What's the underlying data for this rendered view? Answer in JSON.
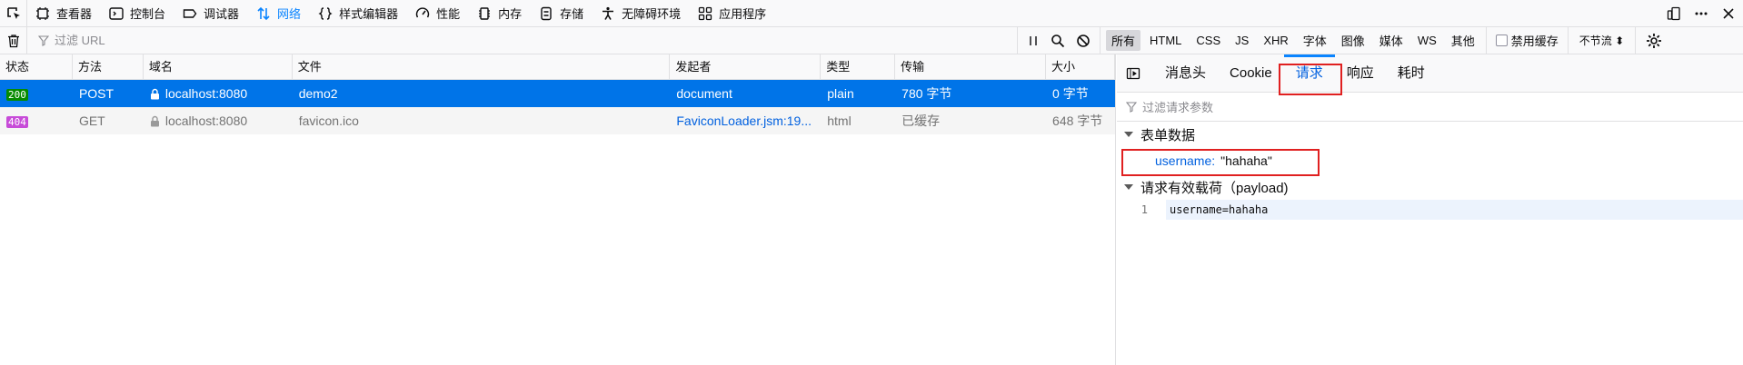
{
  "toolbox": {
    "tabs": [
      {
        "label": "查看器",
        "icon": "inspector-icon"
      },
      {
        "label": "控制台",
        "icon": "console-icon"
      },
      {
        "label": "调试器",
        "icon": "debugger-icon"
      },
      {
        "label": "网络",
        "icon": "network-icon",
        "active": true
      },
      {
        "label": "样式编辑器",
        "icon": "style-editor-icon"
      },
      {
        "label": "性能",
        "icon": "performance-icon"
      },
      {
        "label": "内存",
        "icon": "memory-icon"
      },
      {
        "label": "存储",
        "icon": "storage-icon"
      },
      {
        "label": "无障碍环境",
        "icon": "accessibility-icon"
      },
      {
        "label": "应用程序",
        "icon": "application-icon"
      }
    ]
  },
  "filterbar": {
    "placeholder": "过滤 URL",
    "type_filters": [
      "所有",
      "HTML",
      "CSS",
      "JS",
      "XHR",
      "字体",
      "图像",
      "媒体",
      "WS",
      "其他"
    ],
    "active_filter": "所有",
    "disable_cache_label": "禁用缓存",
    "throttle_label": "不节流 ⬍"
  },
  "table": {
    "headers": [
      "状态",
      "方法",
      "域名",
      "文件",
      "发起者",
      "类型",
      "传输",
      "大小"
    ],
    "rows": [
      {
        "status": "200",
        "method": "POST",
        "domain": "localhost:8080",
        "file": "demo2",
        "initiator": "document",
        "type": "plain",
        "transferred": "780 字节",
        "size": "0 字节"
      },
      {
        "status": "404",
        "method": "GET",
        "domain": "localhost:8080",
        "file": "favicon.ico",
        "initiator": "FaviconLoader.jsm:19...",
        "type": "html",
        "transferred": "已缓存",
        "size": "648 字节"
      }
    ]
  },
  "details": {
    "tabs": [
      "消息头",
      "Cookie",
      "请求",
      "响应",
      "耗时"
    ],
    "active_tab": "请求",
    "param_filter_placeholder": "过滤请求参数",
    "form_section": "表单数据",
    "form_key": "username:",
    "form_value": "\"hahaha\"",
    "payload_section": "请求有效载荷（payload)",
    "payload_line_no": "1",
    "payload_code": "username=hahaha"
  },
  "colors": {
    "accent": "#0a84ff",
    "selected_row": "#0074e8",
    "status_ok": "#058b00",
    "status_404": "#c74bd8",
    "highlight_box": "#e02020"
  }
}
